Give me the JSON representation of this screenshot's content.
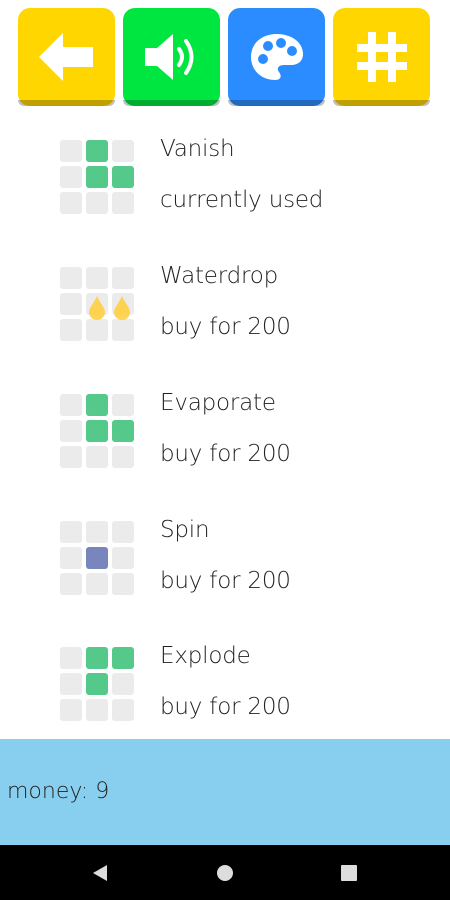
{
  "toolbar": {
    "buttons": [
      {
        "icon": "back-arrow-icon",
        "color": "#ffd600"
      },
      {
        "icon": "speaker-icon",
        "color": "#00e640"
      },
      {
        "icon": "palette-icon",
        "color": "#2b8cff"
      },
      {
        "icon": "hash-icon",
        "color": "#ffd600"
      }
    ]
  },
  "effects": [
    {
      "name": "Vanish",
      "status": "currently used"
    },
    {
      "name": "Waterdrop",
      "status": "buy for 200"
    },
    {
      "name": "Evaporate",
      "status": "buy for 200"
    },
    {
      "name": "Spin",
      "status": "buy for 200"
    },
    {
      "name": "Explode",
      "status": "buy for 200"
    }
  ],
  "footer": {
    "money_text": "money: 9"
  },
  "colors": {
    "footer_bg": "#87ceef",
    "tile_green": "#55c98a",
    "tile_blue": "#7986bd",
    "tile_empty": "#ebebeb",
    "drop_yellow": "#ffcf40"
  }
}
